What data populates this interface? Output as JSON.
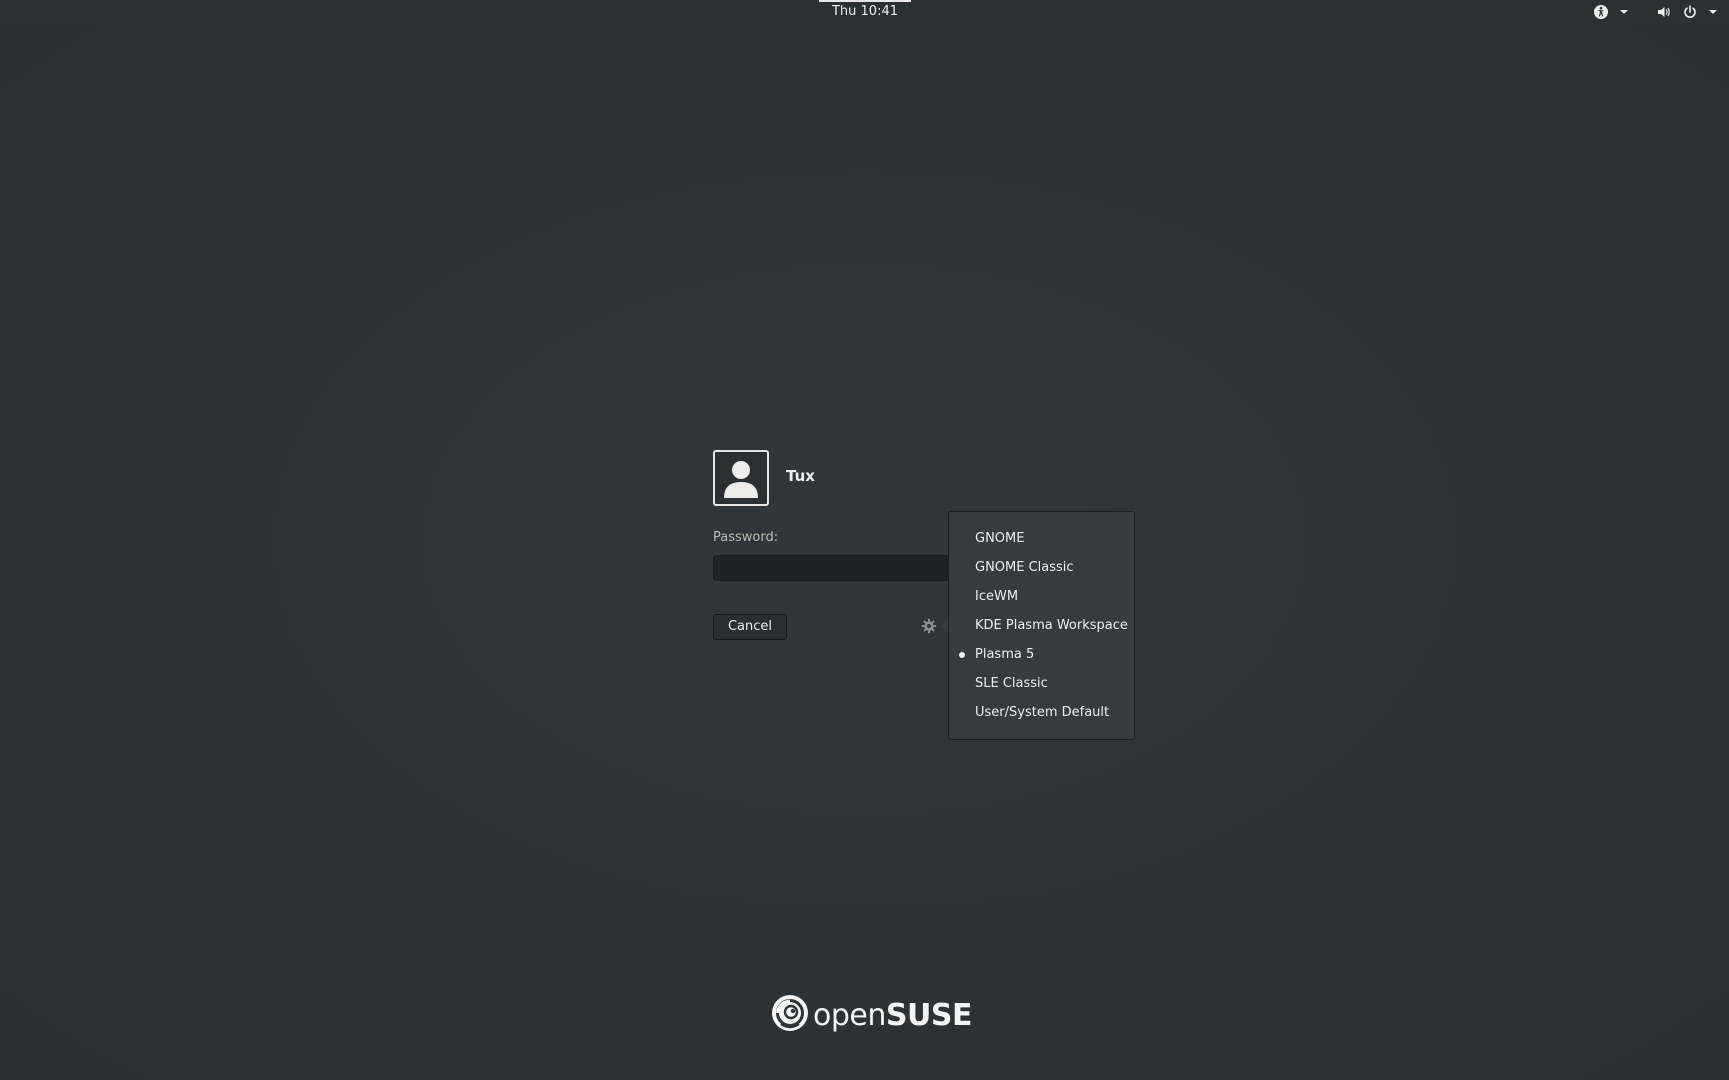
{
  "topbar": {
    "clock": "Thu 10:41",
    "icons": [
      "accessibility-icon",
      "chevron-down-icon",
      "volume-icon",
      "power-icon",
      "chevron-down-icon"
    ]
  },
  "login": {
    "username": "Tux",
    "password_label": "Password:",
    "password_value": "",
    "cancel_label": "Cancel"
  },
  "session_menu": {
    "items": [
      {
        "label": "GNOME",
        "selected": false
      },
      {
        "label": "GNOME Classic",
        "selected": false
      },
      {
        "label": "IceWM",
        "selected": false
      },
      {
        "label": "KDE Plasma Workspace",
        "selected": false
      },
      {
        "label": "Plasma 5",
        "selected": true
      },
      {
        "label": "SLE Classic",
        "selected": false
      },
      {
        "label": "User/System Default",
        "selected": false
      }
    ]
  },
  "branding": {
    "logo_open": "open",
    "logo_suse": "SUSE"
  },
  "colors": {
    "background": "#2e3336",
    "menu_background": "#363b3e",
    "text": "#eeeeec"
  }
}
